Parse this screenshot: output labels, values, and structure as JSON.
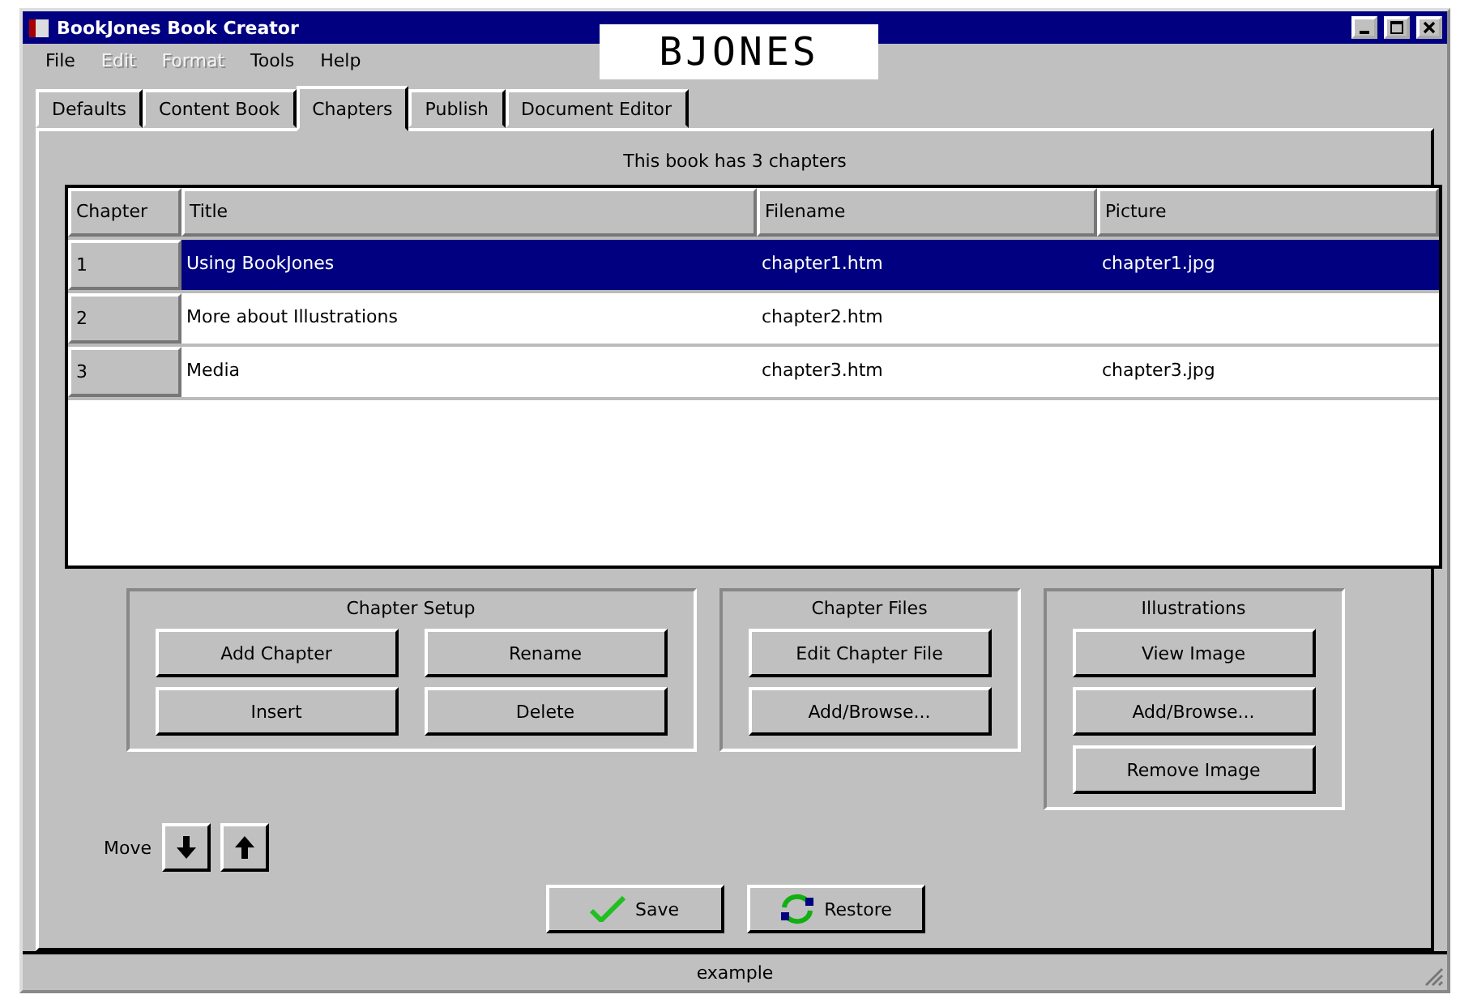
{
  "window": {
    "title": "BookJones Book Creator",
    "user_badge": "BJONES"
  },
  "menu": [
    {
      "label": "File",
      "disabled": false
    },
    {
      "label": "Edit",
      "disabled": true
    },
    {
      "label": "Format",
      "disabled": true
    },
    {
      "label": "Tools",
      "disabled": false
    },
    {
      "label": "Help",
      "disabled": false
    }
  ],
  "tabs": [
    {
      "label": "Defaults",
      "selected": false
    },
    {
      "label": "Content Book",
      "selected": false
    },
    {
      "label": "Chapters",
      "selected": true
    },
    {
      "label": "Publish",
      "selected": false
    },
    {
      "label": "Document Editor",
      "selected": false
    }
  ],
  "summary": "This book has 3 chapters",
  "table": {
    "columns": [
      "Chapter",
      "Title",
      "Filename",
      "Picture"
    ],
    "rows": [
      {
        "cells": [
          "1",
          "Using BookJones",
          "chapter1.htm",
          "chapter1.jpg"
        ],
        "selected": true
      },
      {
        "cells": [
          "2",
          "More about Illustrations",
          "chapter2.htm",
          ""
        ],
        "selected": false
      },
      {
        "cells": [
          "3",
          "Media",
          "chapter3.htm",
          "chapter3.jpg"
        ],
        "selected": false
      }
    ]
  },
  "groups": [
    {
      "title": "Chapter Setup",
      "buttons": [
        "Add Chapter",
        "Rename",
        "Insert",
        "Delete"
      ]
    },
    {
      "title": "Chapter Files",
      "buttons": [
        "Edit Chapter File",
        "Add/Browse..."
      ]
    },
    {
      "title": "Illustrations",
      "buttons": [
        "View Image",
        "Add/Browse...",
        "Remove Image"
      ]
    }
  ],
  "move": {
    "label": "Move"
  },
  "actions": [
    {
      "label": "Save",
      "kind": "save"
    },
    {
      "label": "Restore",
      "kind": "restore"
    }
  ],
  "status_bar": "example"
}
